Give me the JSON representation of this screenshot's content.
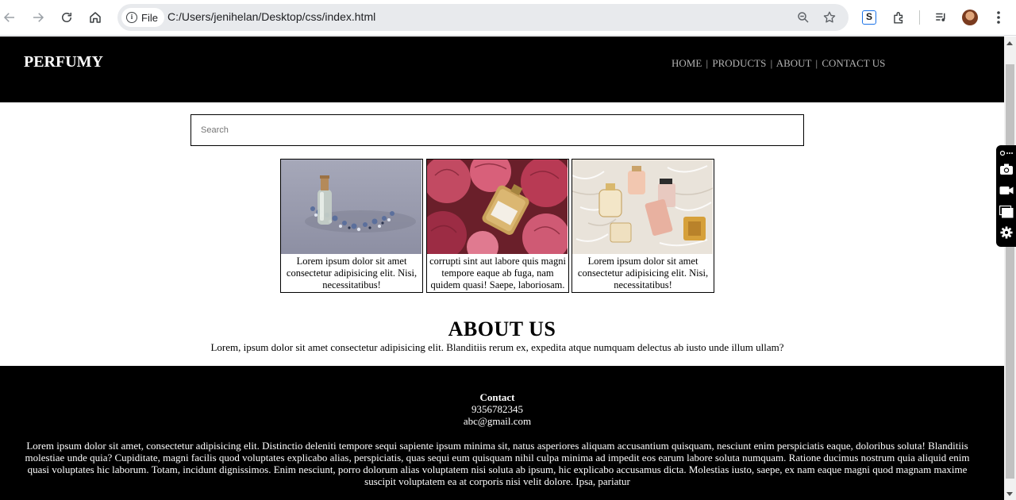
{
  "browser": {
    "file_chip_label": "File",
    "url": "C:/Users/jenihelan/Desktop/css/index.html",
    "extension_letter": "S"
  },
  "site": {
    "logo": "PERFUMY",
    "nav": [
      {
        "label": "HOME"
      },
      {
        "label": "PRODUCTS"
      },
      {
        "label": "ABOUT"
      },
      {
        "label": "CONTACT US"
      }
    ],
    "nav_separator": "|",
    "search_placeholder": "Search",
    "products": [
      {
        "caption": "Lorem ipsum dolor sit amet consectetur adipisicing elit. Nisi, necessitatibus!"
      },
      {
        "caption": "corrupti sint aut labore quis magni tempore eaque ab fuga, nam quidem quasi! Saepe, laboriosam."
      },
      {
        "caption": "Lorem ipsum dolor sit amet consectetur adipisicing elit. Nisi, necessitatibus!"
      }
    ],
    "about": {
      "title": "ABOUT US",
      "text": "Lorem, ipsum dolor sit amet consectetur adipisicing elit. Blanditiis rerum ex, expedita atque numquam delectus ab iusto unde illum ullam?"
    },
    "footer": {
      "contact_heading": "Contact",
      "phone": "9356782345",
      "email": "abc@gmail.com",
      "text": "Lorem ipsum dolor sit amet, consectetur adipisicing elit. Distinctio deleniti tempore sequi sapiente ipsum minima sit, natus asperiores aliquam accusantium quisquam, nesciunt enim perspiciatis eaque, doloribus soluta! Blanditiis molestiae unde quia? Cupiditate, magni facilis quod voluptates explicabo alias, perspiciatis, quas sequi eum quisquam nihil culpa minima ad impedit eos earum labore soluta numquam. Ratione ducimus nostrum quia aliquid enim quasi voluptates hic laborum. Totam, incidunt dignissimos. Enim nesciunt, porro dolorum alias voluptatem nisi soluta ab ipsum, hic explicabo accusamus dicta. Molestias iusto, saepe, ex nam eaque magni quod magnam maxime suscipit voluptatem ea at corporis nisi velit dolore. Ipsa, pariatur"
    }
  },
  "colors": {
    "header_bg": "#000000",
    "footer_bg": "#000000",
    "nav_text": "#b3b3b3",
    "omnibox_bg": "#e8eaed"
  }
}
